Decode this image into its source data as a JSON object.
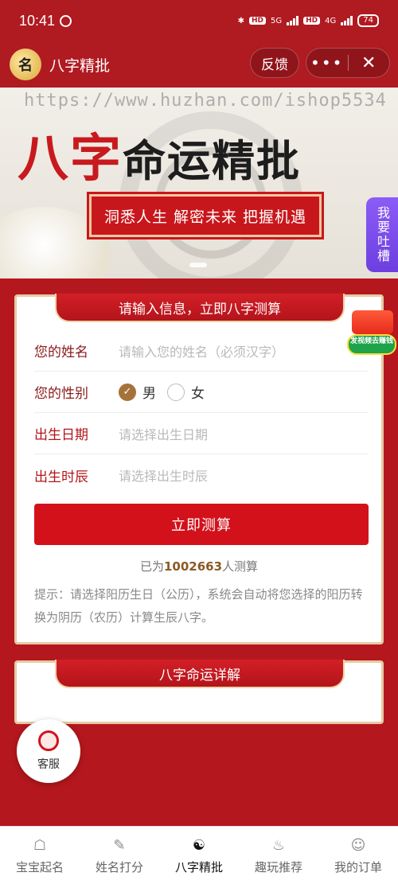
{
  "status_bar": {
    "time": "10:41",
    "network_5g": "5G",
    "network_4g": "4G",
    "hd": "HD",
    "battery": "74"
  },
  "header": {
    "logo_char": "名",
    "title": "八字精批",
    "feedback_label": "反馈",
    "more_label": "•••",
    "close_label": "✕"
  },
  "banner": {
    "watermark": "https://www.huzhan.com/ishop5534",
    "title_part1": "八字",
    "title_part2": "命运精批",
    "slogan": "洞悉人生 解密未来 把握机遇"
  },
  "side_button": {
    "label": "我要吐槽"
  },
  "video_badge": {
    "label": "发视频去赚钱"
  },
  "form": {
    "heading": "请输入信息，立即八字测算",
    "name_label": "您的姓名",
    "name_placeholder": "请输入您的姓名（必须汉字）",
    "gender_label": "您的性别",
    "gender_options": [
      {
        "label": "男",
        "selected": true
      },
      {
        "label": "女",
        "selected": false
      }
    ],
    "birth_date_label": "出生日期",
    "birth_date_placeholder": "请选择出生日期",
    "birth_hour_label": "出生时辰",
    "birth_hour_placeholder": "请选择出生时辰",
    "submit_label": "立即测算",
    "count_prefix": "已为",
    "count_value": "1002663",
    "count_suffix": "人测算",
    "tip": "提示：请选择阳历生日（公历），系统会自动将您选择的阳历转换为阴历（农历）计算生辰八字。"
  },
  "section2": {
    "heading": "八字命运详解"
  },
  "customer_service": {
    "label": "客服"
  },
  "tabs": [
    {
      "label": "宝宝起名",
      "icon": "baby-icon",
      "active": false
    },
    {
      "label": "姓名打分",
      "icon": "score-icon",
      "active": false
    },
    {
      "label": "八字精批",
      "icon": "yin-yang-icon",
      "active": true
    },
    {
      "label": "趣玩推荐",
      "icon": "flame-icon",
      "active": false
    },
    {
      "label": "我的订单",
      "icon": "user-icon",
      "active": false
    }
  ],
  "colors": {
    "primary_red": "#b5171e",
    "button_red": "#d3111b",
    "gold": "#a5733a"
  }
}
